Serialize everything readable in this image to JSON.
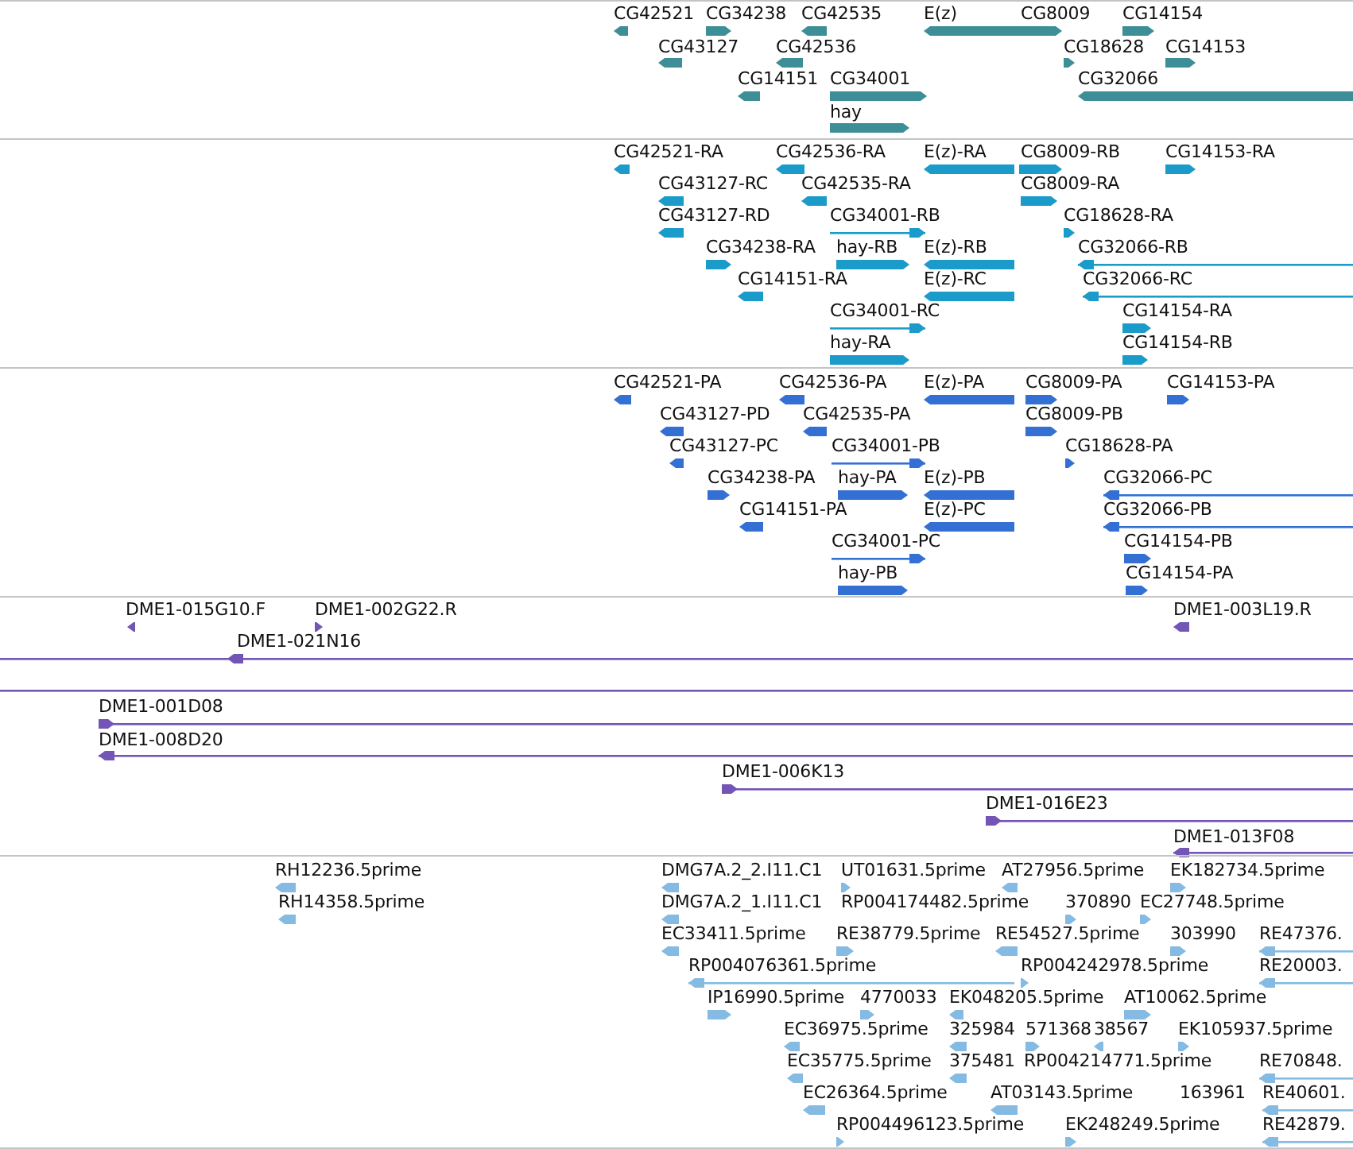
{
  "tracks": [
    {
      "color": "#3d8e96",
      "features": [
        {
          "label": "CG42521",
          "kind": "block",
          "reverse": true
        },
        {
          "label": "CG34238",
          "kind": "block",
          "reverse": false
        },
        {
          "label": "CG42535",
          "kind": "block",
          "reverse": true
        },
        {
          "label": "E(z)",
          "kind": "block",
          "reverse": true
        },
        {
          "label": "CG8009",
          "kind": "block",
          "reverse": false
        },
        {
          "label": "CG14154",
          "kind": "block",
          "reverse": false
        },
        {
          "label": "CG43127",
          "kind": "block",
          "reverse": true
        },
        {
          "label": "CG42536",
          "kind": "block",
          "reverse": true
        },
        {
          "label": "CG18628",
          "kind": "block",
          "reverse": false
        },
        {
          "label": "CG14153",
          "kind": "block",
          "reverse": false
        },
        {
          "label": "CG14151",
          "kind": "block",
          "reverse": true
        },
        {
          "label": "CG34001",
          "kind": "block",
          "reverse": false
        },
        {
          "label": "CG32066",
          "kind": "block",
          "reverse": true
        },
        {
          "label": "hay",
          "kind": "block",
          "reverse": false
        }
      ]
    },
    {
      "color": "#1b9bc9",
      "features": [
        {
          "label": "CG42521-RA",
          "kind": "block",
          "reverse": true
        },
        {
          "label": "CG42536-RA",
          "kind": "block",
          "reverse": true
        },
        {
          "label": "E(z)-RA",
          "kind": "block",
          "reverse": true
        },
        {
          "label": "CG8009-RB",
          "kind": "block",
          "reverse": false
        },
        {
          "label": "CG14153-RA",
          "kind": "block",
          "reverse": false
        },
        {
          "label": "CG43127-RC",
          "kind": "block",
          "reverse": true
        },
        {
          "label": "CG42535-RA",
          "kind": "block",
          "reverse": true
        },
        {
          "label": "CG8009-RA",
          "kind": "block",
          "reverse": false
        },
        {
          "label": "CG43127-RD",
          "kind": "block",
          "reverse": true
        },
        {
          "label": "CG34001-RB",
          "kind": "line",
          "reverse": false
        },
        {
          "label": "CG18628-RA",
          "kind": "block",
          "reverse": false
        },
        {
          "label": "CG34238-RA",
          "kind": "block",
          "reverse": false
        },
        {
          "label": "hay-RB",
          "kind": "block",
          "reverse": false
        },
        {
          "label": "E(z)-RB",
          "kind": "block",
          "reverse": true
        },
        {
          "label": "CG32066-RB",
          "kind": "line",
          "reverse": true
        },
        {
          "label": "CG14151-RA",
          "kind": "block",
          "reverse": true
        },
        {
          "label": "E(z)-RC",
          "kind": "block",
          "reverse": true
        },
        {
          "label": "CG32066-RC",
          "kind": "line",
          "reverse": true
        },
        {
          "label": "CG34001-RC",
          "kind": "line",
          "reverse": false
        },
        {
          "label": "CG14154-RA",
          "kind": "block",
          "reverse": false
        },
        {
          "label": "hay-RA",
          "kind": "block",
          "reverse": false
        },
        {
          "label": "CG14154-RB",
          "kind": "block",
          "reverse": false
        }
      ]
    },
    {
      "color": "#3470d3",
      "features": [
        {
          "label": "CG42521-PA",
          "kind": "block",
          "reverse": true
        },
        {
          "label": "CG42536-PA",
          "kind": "block",
          "reverse": true
        },
        {
          "label": "E(z)-PA",
          "kind": "block",
          "reverse": true
        },
        {
          "label": "CG8009-PA",
          "kind": "block",
          "reverse": false
        },
        {
          "label": "CG14153-PA",
          "kind": "block",
          "reverse": false
        },
        {
          "label": "CG43127-PD",
          "kind": "block",
          "reverse": true
        },
        {
          "label": "CG42535-PA",
          "kind": "block",
          "reverse": true
        },
        {
          "label": "CG8009-PB",
          "kind": "block",
          "reverse": false
        },
        {
          "label": "CG43127-PC",
          "kind": "block",
          "reverse": true
        },
        {
          "label": "CG34001-PB",
          "kind": "line",
          "reverse": false
        },
        {
          "label": "CG18628-PA",
          "kind": "block",
          "reverse": false
        },
        {
          "label": "CG34238-PA",
          "kind": "block",
          "reverse": false
        },
        {
          "label": "hay-PA",
          "kind": "block",
          "reverse": false
        },
        {
          "label": "E(z)-PB",
          "kind": "block",
          "reverse": true
        },
        {
          "label": "CG32066-PC",
          "kind": "line",
          "reverse": true
        },
        {
          "label": "CG14151-PA",
          "kind": "block",
          "reverse": true
        },
        {
          "label": "E(z)-PC",
          "kind": "block",
          "reverse": true
        },
        {
          "label": "CG32066-PB",
          "kind": "line",
          "reverse": true
        },
        {
          "label": "CG34001-PC",
          "kind": "line",
          "reverse": false
        },
        {
          "label": "CG14154-PB",
          "kind": "block",
          "reverse": false
        },
        {
          "label": "hay-PB",
          "kind": "block",
          "reverse": false
        },
        {
          "label": "CG14154-PA",
          "kind": "block",
          "reverse": false
        }
      ]
    },
    {
      "color": "#7355b5",
      "features": [
        {
          "label": "DME1-015G10.F",
          "kind": "block",
          "reverse": true
        },
        {
          "label": "DME1-002G22.R",
          "kind": "block",
          "reverse": false
        },
        {
          "label": "DME1-003L19.R",
          "kind": "block",
          "reverse": true
        },
        {
          "label": "DME1-021N16",
          "kind": "line",
          "reverse": true
        },
        {
          "kind": "span"
        },
        {
          "label": "DME1-001D08",
          "kind": "line",
          "reverse": false
        },
        {
          "label": "DME1-008D20",
          "kind": "line",
          "reverse": true
        },
        {
          "label": "DME1-006K13",
          "kind": "line",
          "reverse": false
        },
        {
          "label": "DME1-016E23",
          "kind": "line",
          "reverse": false
        },
        {
          "label": "DME1-013F08",
          "kind": "line",
          "reverse": true
        }
      ]
    },
    {
      "color": "#85bbe2",
      "features": [
        {
          "label": "RH12236.5prime",
          "kind": "block",
          "reverse": true
        },
        {
          "label": "DMG7A.2_2.I11.C1",
          "kind": "block",
          "reverse": true
        },
        {
          "label": "UT01631.5prime",
          "kind": "block",
          "reverse": false
        },
        {
          "label": "AT27956.5prime",
          "kind": "block",
          "reverse": true
        },
        {
          "label": "EK182734.5prime",
          "kind": "block",
          "reverse": false
        },
        {
          "label": "RH14358.5prime",
          "kind": "block",
          "reverse": true
        },
        {
          "label": "DMG7A.2_1.I11.C1",
          "kind": "block",
          "reverse": true
        },
        {
          "label": "RP004174482.5prime",
          "kind": "label"
        },
        {
          "label": "370890",
          "kind": "block",
          "reverse": false
        },
        {
          "label": "EC27748.5prime",
          "kind": "block",
          "reverse": false
        },
        {
          "label": "EC33411.5prime",
          "kind": "block",
          "reverse": true
        },
        {
          "label": "RE38779.5prime",
          "kind": "block",
          "reverse": false
        },
        {
          "label": "RE54527.5prime",
          "kind": "block",
          "reverse": true
        },
        {
          "label": "303990",
          "kind": "block",
          "reverse": false
        },
        {
          "label": "RE47376.",
          "kind": "line",
          "reverse": true
        },
        {
          "label": "RP004076361.5prime",
          "kind": "line",
          "reverse": true
        },
        {
          "label": "RP004242978.5prime",
          "kind": "block",
          "reverse": false
        },
        {
          "label": "RE20003.",
          "kind": "line",
          "reverse": true
        },
        {
          "label": "IP16990.5prime",
          "kind": "block",
          "reverse": false
        },
        {
          "label": "4770033",
          "kind": "block",
          "reverse": false
        },
        {
          "label": "EK048205.5prime",
          "kind": "block",
          "reverse": true
        },
        {
          "label": "AT10062.5prime",
          "kind": "block",
          "reverse": false
        },
        {
          "label": "EC36975.5prime",
          "kind": "block",
          "reverse": true
        },
        {
          "label": "325984",
          "kind": "block",
          "reverse": true
        },
        {
          "label": "571368",
          "kind": "block",
          "reverse": false
        },
        {
          "label": "38567",
          "kind": "block",
          "reverse": true
        },
        {
          "label": "EK105937.5prime",
          "kind": "block",
          "reverse": false
        },
        {
          "label": "EC35775.5prime",
          "kind": "block",
          "reverse": true
        },
        {
          "label": "375481",
          "kind": "block",
          "reverse": true
        },
        {
          "label": "RP004214771.5prime",
          "kind": "label"
        },
        {
          "label": "RE70848.",
          "kind": "line",
          "reverse": true
        },
        {
          "label": "EC26364.5prime",
          "kind": "block",
          "reverse": true
        },
        {
          "label": "AT03143.5prime",
          "kind": "block",
          "reverse": true
        },
        {
          "label": "163961",
          "kind": "label"
        },
        {
          "label": "RE40601.",
          "kind": "line",
          "reverse": true
        },
        {
          "label": "RP004496123.5prime",
          "kind": "block",
          "reverse": false
        },
        {
          "label": "EK248249.5prime",
          "kind": "block",
          "reverse": false
        },
        {
          "label": "RE42879.",
          "kind": "line",
          "reverse": true
        }
      ]
    }
  ]
}
